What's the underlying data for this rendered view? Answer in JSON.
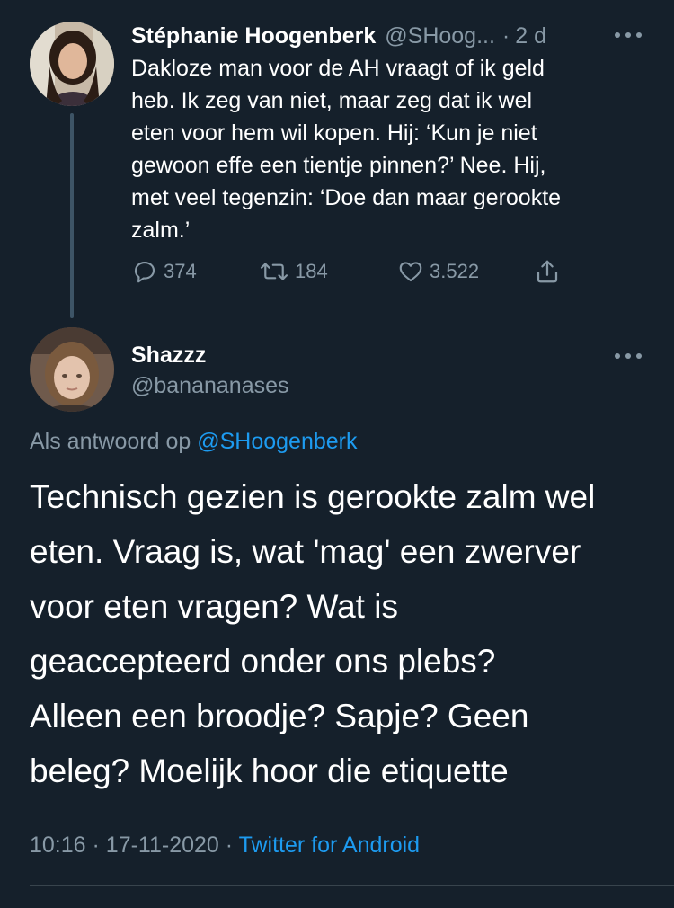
{
  "colors": {
    "background": "#15202b",
    "text_primary": "#ffffff",
    "text_secondary": "#8899a6",
    "accent": "#1d9bf0",
    "thread_line": "#3d5466"
  },
  "parent_tweet": {
    "author_name": "Stéphanie Hoogenberk",
    "author_handle": "@SHoog...",
    "separator": "·",
    "time": "2 d",
    "text": "Dakloze man voor de AH vraagt of ik geld\nheb. Ik zeg van niet, maar zeg dat ik wel\neten voor hem wil kopen. Hij: ‘Kun je niet\ngewoon effe een tientje pinnen?’ Nee. Hij,\nmet veel tegenzin: ‘Doe dan maar gerookte\nzalm.’",
    "actions": {
      "reply_icon": "reply-icon",
      "reply_count": "374",
      "retweet_icon": "retweet-icon",
      "retweet_count": "184",
      "like_icon": "heart-icon",
      "like_count": "3.522",
      "share_icon": "share-icon"
    },
    "more_icon": "more-options-icon"
  },
  "reply_tweet": {
    "author_name": "Shazzz",
    "author_handle": "@banananases",
    "more_icon": "more-options-icon",
    "reply_prefix": "Als antwoord op",
    "reply_mention": "@SHoogenberk",
    "text": "Technisch gezien is gerookte zalm wel\neten. Vraag is, wat 'mag' een zwerver\nvoor eten vragen? Wat is\ngeaccepteerd onder ons plebs?\nAlleen een broodje? Sapje? Geen\nbeleg? Moelijk hoor die etiquette",
    "time": "10:16",
    "separator": "·",
    "date": "17-11-2020",
    "source": "Twitter for Android"
  }
}
